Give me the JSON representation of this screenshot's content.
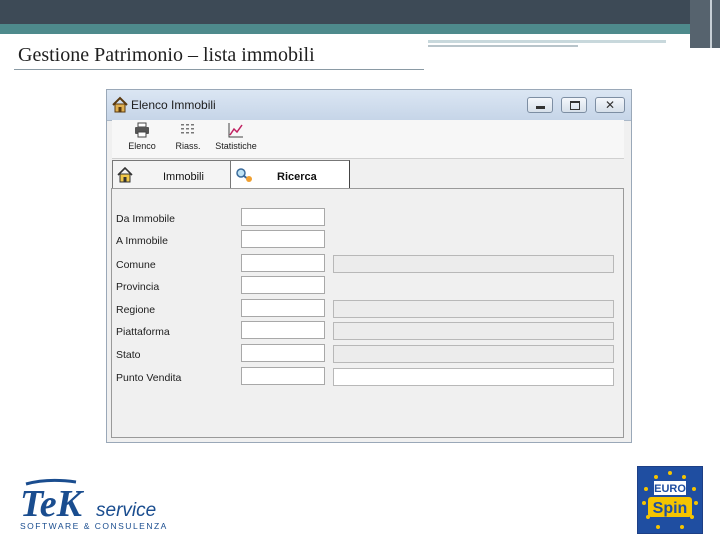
{
  "slide": {
    "title": "Gestione Patrimonio – lista immobili"
  },
  "window": {
    "title": "Elenco Immobili",
    "controls": {
      "close_symbol": "✕"
    }
  },
  "toolbar": {
    "items": [
      {
        "label": "Elenco",
        "icon": "printer-icon"
      },
      {
        "label": "Riass.",
        "icon": "summary-icon"
      },
      {
        "label": "Statistiche",
        "icon": "chart-icon"
      }
    ]
  },
  "tabs": [
    {
      "label": "Immobili",
      "icon": "home-icon",
      "active": false
    },
    {
      "label": "Ricerca",
      "icon": "search-icon",
      "active": true
    }
  ],
  "form": {
    "fields": [
      {
        "label": "Da Immobile",
        "value": ""
      },
      {
        "label": "A Immobile",
        "value": ""
      },
      {
        "label": "Comune",
        "value": "",
        "description": ""
      },
      {
        "label": "Provincia",
        "value": ""
      },
      {
        "label": "Regione",
        "value": "",
        "description": ""
      },
      {
        "label": "Piattaforma",
        "value": "",
        "description": ""
      },
      {
        "label": "Stato",
        "value": "",
        "description": ""
      },
      {
        "label": "Punto Vendita",
        "value": "",
        "description": ""
      }
    ]
  },
  "logos": {
    "tek": {
      "letters": "TeK",
      "word": "service",
      "tagline": "SOFTWARE & CONSULENZA"
    },
    "eurospin": {
      "top": "EURO",
      "bottom": "Spin"
    }
  },
  "colors": {
    "header_dark": "#3d4a56",
    "header_teal": "#4e8a8c",
    "eurospin_blue": "#1f4ea1",
    "eurospin_yellow": "#f5c400"
  }
}
